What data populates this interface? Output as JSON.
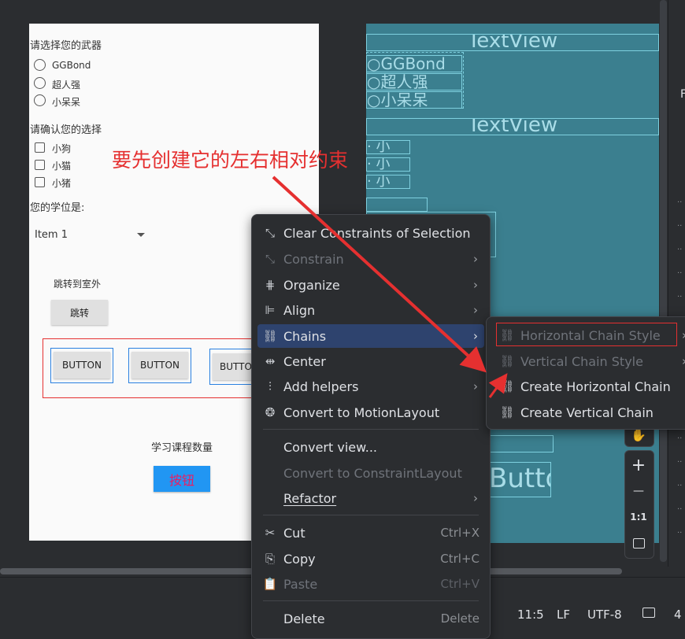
{
  "design": {
    "weapon_prompt": "请选择您的武器",
    "weapons": [
      "GGBond",
      "超人强",
      "小呆呆"
    ],
    "confirm_prompt": "请确认您的选择",
    "pets": [
      "小狗",
      "小猫",
      "小猪"
    ],
    "degree_label": "您的学位是:",
    "spinner_value": "Item 1",
    "jump_label": "跳转到室外",
    "jump_button": "跳转",
    "buttons": [
      "BUTTON",
      "BUTTON",
      "BUTTO"
    ],
    "course_label": "学习课程数量",
    "accent_button": "按钮"
  },
  "blueprint": {
    "textview_1": "TextView",
    "radios": [
      "○GGBond",
      "○超人强",
      "○小呆呆"
    ],
    "textview_2": "TextView",
    "checks": [
      "· 小",
      "· 小",
      "· 小"
    ],
    "button_text": "Butto"
  },
  "annotation": {
    "text": "要先创建它的左右相对约束",
    "color": "#e53030"
  },
  "context_menu": {
    "items": [
      {
        "label": "Clear Constraints of Selection",
        "icon": "clear-constraints-icon"
      },
      {
        "label": "Constrain",
        "icon": "constrain-icon",
        "disabled": true,
        "submenu": true
      },
      {
        "label": "Organize",
        "icon": "organize-icon",
        "submenu": true
      },
      {
        "label": "Align",
        "icon": "align-icon",
        "submenu": true
      },
      {
        "label": "Chains",
        "icon": "chain-icon",
        "submenu": true,
        "highlighted": true
      },
      {
        "label": "Center",
        "icon": "center-icon",
        "submenu": true
      },
      {
        "label": "Add helpers",
        "icon": "helpers-icon",
        "submenu": true
      },
      {
        "label": "Convert to MotionLayout",
        "icon": "motionlayout-icon"
      },
      {
        "label": "Convert view...",
        "icon": ""
      },
      {
        "label": "Convert to ConstraintLayout",
        "icon": "",
        "disabled": true
      },
      {
        "label": "Refactor",
        "icon": "",
        "submenu": true
      },
      {
        "label": "Cut",
        "icon": "cut-icon",
        "shortcut": "Ctrl+X"
      },
      {
        "label": "Copy",
        "icon": "copy-icon",
        "shortcut": "Ctrl+C"
      },
      {
        "label": "Paste",
        "icon": "paste-icon",
        "shortcut": "Ctrl+V",
        "disabled": true
      },
      {
        "label": "Delete",
        "icon": "",
        "shortcut": "Delete"
      }
    ]
  },
  "chains_submenu": {
    "items": [
      {
        "label": "Horizontal Chain Style",
        "disabled": true,
        "submenu": true
      },
      {
        "label": "Vertical Chain Style",
        "disabled": true,
        "submenu": true
      },
      {
        "label": "Create Horizontal Chain"
      },
      {
        "label": "Create Vertical Chain"
      }
    ]
  },
  "zoom_controls": [
    "+",
    "—",
    "1:1"
  ],
  "status_bar": {
    "position": "11:5",
    "line_ending": "LF",
    "encoding": "UTF-8",
    "indent": "4"
  },
  "colors": {
    "menu_bg": "#2b2d30",
    "menu_highlight": "#2e436e",
    "blueprint": "#3b7f8f",
    "accent_button": "#2196f3",
    "accent_text": "#e91e63"
  }
}
